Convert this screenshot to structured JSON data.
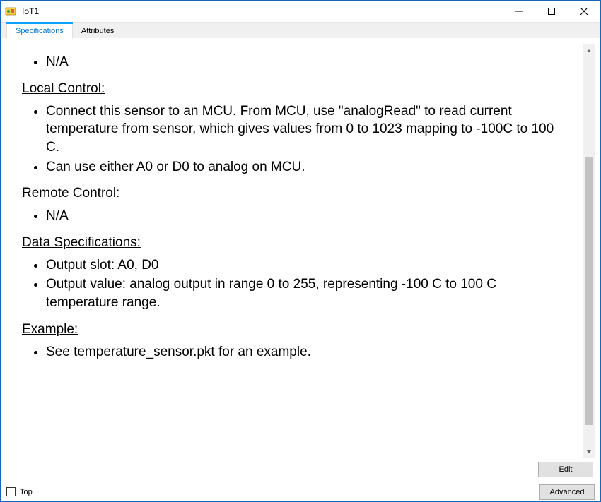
{
  "window": {
    "title": "IoT1"
  },
  "tabs": {
    "specifications": "Specifications",
    "attributes": "Attributes"
  },
  "content": {
    "na1": "N/A",
    "local_control_hdr": "Local Control:",
    "local_control_items": {
      "i0": "Connect this sensor to an MCU. From MCU, use \"analogRead\" to read current temperature from sensor, which gives values from 0 to 1023 mapping to -100C to 100 C.",
      "i1": "Can use either A0 or D0 to analog on MCU."
    },
    "remote_control_hdr": "Remote Control:",
    "remote_control_items": {
      "i0": "N/A"
    },
    "data_specifications_hdr": "Data Specifications:",
    "data_specifications_items": {
      "i0": "Output slot: A0, D0",
      "i1": "Output value: analog output in range 0 to 255, representing -100 C to 100 C temperature range."
    },
    "example_hdr": "Example:",
    "example_items": {
      "i0": "See temperature_sensor.pkt for an example."
    }
  },
  "buttons": {
    "edit": "Edit",
    "advanced": "Advanced"
  },
  "footer": {
    "top": "Top"
  }
}
